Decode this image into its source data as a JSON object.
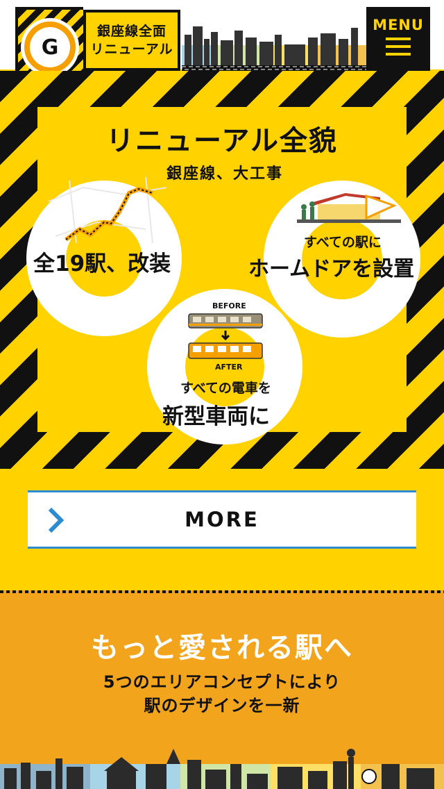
{
  "header": {
    "logo_letter": "G",
    "logo_line1": "銀座線全面",
    "logo_line2": "リニューアル",
    "menu_label": "MENU"
  },
  "hero": {
    "title": "リニューアル全貌",
    "subtitle": "銀座線、大工事",
    "map_line_color": "#f5a000",
    "items": [
      {
        "small": "",
        "big": "全19駅、改装"
      },
      {
        "small": "すべての駅に",
        "big": "ホームドアを設置"
      },
      {
        "small": "すべての電車を",
        "big": "新型車両に",
        "before_label": "BEFORE",
        "after_label": "AFTER"
      }
    ]
  },
  "more_button": {
    "label": "MORE",
    "icon": "chevron-right-icon",
    "accent": "#2d8ccf"
  },
  "concept": {
    "title": "もっと愛される駅へ",
    "line1": "5つのエリアコンセプトにより",
    "line2": "駅のデザインを一新"
  },
  "colors": {
    "brand_yellow": "#ffd200",
    "brand_orange": "#f2a51c",
    "ink": "#111111"
  }
}
